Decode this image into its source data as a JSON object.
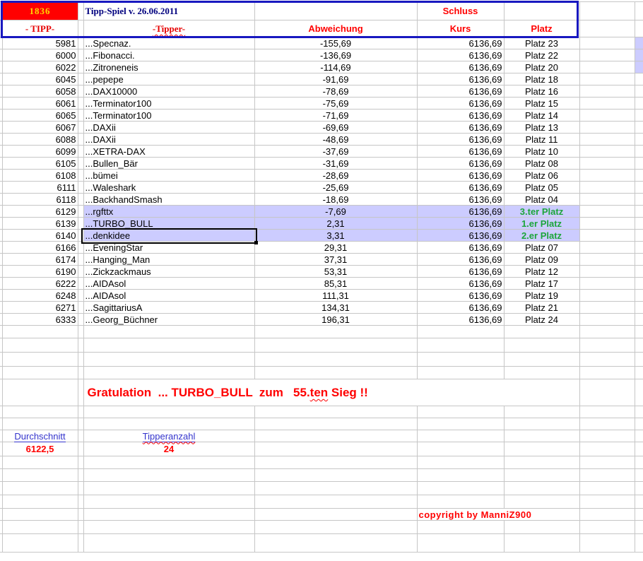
{
  "header": {
    "game_number": "1836",
    "title": "Tipp-Spiel v. 26.06.2011",
    "schluss_label": "Schluss",
    "col_tipp": "- TIPP-",
    "col_tipper": "-Tipper-",
    "col_abweichung": "Abweichung",
    "col_kurs": "Kurs",
    "col_platz": "Platz"
  },
  "rows": [
    {
      "tipp": "5981",
      "tipper": "...Specnaz.",
      "abw": "-155,69",
      "kurs": "6136,69",
      "platz": "Platz 23",
      "hl": false,
      "top": false,
      "edge": true
    },
    {
      "tipp": "6000",
      "tipper": "...Fibonacci.",
      "abw": "-136,69",
      "kurs": "6136,69",
      "platz": "Platz 22",
      "hl": false,
      "top": false,
      "edge": true
    },
    {
      "tipp": "6022",
      "tipper": "...Zitroneneis",
      "abw": "-114,69",
      "kurs": "6136,69",
      "platz": "Platz 20",
      "hl": false,
      "top": false,
      "edge": true
    },
    {
      "tipp": "6045",
      "tipper": "...pepepe",
      "abw": "-91,69",
      "kurs": "6136,69",
      "platz": "Platz 18",
      "hl": false,
      "top": false,
      "edge": false
    },
    {
      "tipp": "6058",
      "tipper": "...DAX10000",
      "abw": "-78,69",
      "kurs": "6136,69",
      "platz": "Platz 16",
      "hl": false,
      "top": false,
      "edge": false
    },
    {
      "tipp": "6061",
      "tipper": "...Terminator100",
      "abw": "-75,69",
      "kurs": "6136,69",
      "platz": "Platz 15",
      "hl": false,
      "top": false,
      "edge": false
    },
    {
      "tipp": "6065",
      "tipper": "...Terminator100",
      "abw": "-71,69",
      "kurs": "6136,69",
      "platz": "Platz 14",
      "hl": false,
      "top": false,
      "edge": false
    },
    {
      "tipp": "6067",
      "tipper": "...DAXii",
      "abw": "-69,69",
      "kurs": "6136,69",
      "platz": "Platz 13",
      "hl": false,
      "top": false,
      "edge": false
    },
    {
      "tipp": "6088",
      "tipper": "...DAXii",
      "abw": "-48,69",
      "kurs": "6136,69",
      "platz": "Platz 11",
      "hl": false,
      "top": false,
      "edge": false
    },
    {
      "tipp": "6099",
      "tipper": "...XETRA-DAX",
      "abw": "-37,69",
      "kurs": "6136,69",
      "platz": "Platz 10",
      "hl": false,
      "top": false,
      "edge": false
    },
    {
      "tipp": "6105",
      "tipper": "...Bullen_Bär",
      "abw": "-31,69",
      "kurs": "6136,69",
      "platz": "Platz 08",
      "hl": false,
      "top": false,
      "edge": false
    },
    {
      "tipp": "6108",
      "tipper": "...bümei",
      "abw": "-28,69",
      "kurs": "6136,69",
      "platz": "Platz 06",
      "hl": false,
      "top": false,
      "edge": false
    },
    {
      "tipp": "6111",
      "tipper": "...Waleshark",
      "abw": "-25,69",
      "kurs": "6136,69",
      "platz": "Platz 05",
      "hl": false,
      "top": false,
      "edge": false
    },
    {
      "tipp": "6118",
      "tipper": "...BackhandSmash",
      "abw": "-18,69",
      "kurs": "6136,69",
      "platz": "Platz 04",
      "hl": false,
      "top": false,
      "edge": false
    },
    {
      "tipp": "6129",
      "tipper": "...rgfttx",
      "abw": "-7,69",
      "kurs": "6136,69",
      "platz": "3.ter Platz",
      "hl": true,
      "top": true,
      "edge": false
    },
    {
      "tipp": "6139",
      "tipper": "...TURBO_BULL",
      "abw": "2,31",
      "kurs": "6136,69",
      "platz": "1.er Platz",
      "hl": true,
      "top": true,
      "edge": false,
      "selected": true
    },
    {
      "tipp": "6140",
      "tipper": "...denkidee",
      "abw": "3,31",
      "kurs": "6136,69",
      "platz": "2.er Platz",
      "hl": true,
      "top": true,
      "edge": false
    },
    {
      "tipp": "6166",
      "tipper": "...EveningStar",
      "abw": "29,31",
      "kurs": "6136,69",
      "platz": "Platz 07",
      "hl": false,
      "top": false,
      "edge": false
    },
    {
      "tipp": "6174",
      "tipper": "...Hanging_Man",
      "abw": "37,31",
      "kurs": "6136,69",
      "platz": "Platz 09",
      "hl": false,
      "top": false,
      "edge": false
    },
    {
      "tipp": "6190",
      "tipper": "...Zickzackmaus",
      "abw": "53,31",
      "kurs": "6136,69",
      "platz": "Platz 12",
      "hl": false,
      "top": false,
      "edge": false
    },
    {
      "tipp": "6222",
      "tipper": "...AIDAsol",
      "abw": "85,31",
      "kurs": "6136,69",
      "platz": "Platz 17",
      "hl": false,
      "top": false,
      "edge": false
    },
    {
      "tipp": "6248",
      "tipper": "...AIDAsol",
      "abw": "111,31",
      "kurs": "6136,69",
      "platz": "Platz 19",
      "hl": false,
      "top": false,
      "edge": false
    },
    {
      "tipp": "6271",
      "tipper": "...SagittariusA",
      "abw": "134,31",
      "kurs": "6136,69",
      "platz": "Platz 21",
      "hl": false,
      "top": false,
      "edge": false
    },
    {
      "tipp": "6333",
      "tipper": "...Georg_Büchner",
      "abw": "196,31",
      "kurs": "6136,69",
      "platz": "Platz 24",
      "hl": false,
      "top": false,
      "edge": false
    }
  ],
  "congrats": {
    "part1": "Gratulation  ... TURBO_BULL  zum   55.",
    "wavy": "ten",
    "part2": " Sieg !!"
  },
  "summary": {
    "avg_label": "Durchschnitt",
    "count_label": "Tipperanzahl",
    "avg_value": "6122,5",
    "count_value": "24"
  },
  "copyright": "copyright by ManniZ900",
  "colors": {
    "highlight": "#ccccff",
    "rank_green": "#1ca53a",
    "accent_red": "#ff0000",
    "header_border_blue": "#1818c0",
    "title_navy": "#00007f",
    "label_blue": "#3333cc",
    "game_number_yellow": "#ffd700",
    "game_number_bg": "#ff0000"
  }
}
